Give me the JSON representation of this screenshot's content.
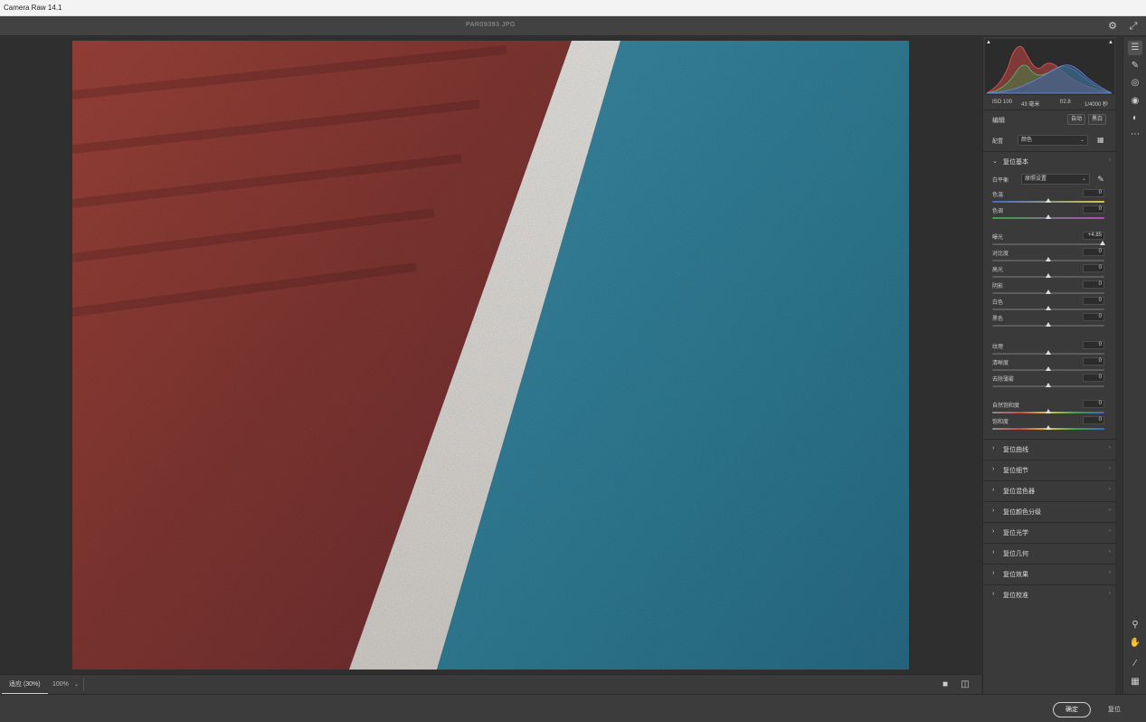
{
  "window": {
    "title": "Camera Raw 14.1"
  },
  "topbar": {
    "filename": "PAR09393.JPG",
    "settings_icon": "gear-icon",
    "fullscreen_icon": "expand-icon"
  },
  "histogram": {
    "exif": {
      "iso": "ISO 100",
      "focal": "43 毫米",
      "aperture": "f/2.8",
      "shutter": "1/4000 秒"
    }
  },
  "edit": {
    "label": "编辑",
    "auto": "自动",
    "bw": "黑白"
  },
  "profile": {
    "label": "配置",
    "value": "颜色"
  },
  "basic": {
    "title": "复位基本",
    "wb_label": "白平衡",
    "wb_value": "原照设置",
    "sliders": [
      {
        "label": "色温",
        "value": "0",
        "pos": 0.5,
        "track": "linear-gradient(90deg,#3f67c9,#d8c64a)"
      },
      {
        "label": "色调",
        "value": "0",
        "pos": 0.5,
        "track": "linear-gradient(90deg,#3fa04a,#b04ab8)"
      },
      {
        "label": "曝光",
        "value": "+4.85",
        "pos": 0.98,
        "track": ""
      },
      {
        "label": "对比度",
        "value": "0",
        "pos": 0.5,
        "track": ""
      },
      {
        "label": "高光",
        "value": "0",
        "pos": 0.5,
        "track": ""
      },
      {
        "label": "阴影",
        "value": "0",
        "pos": 0.5,
        "track": ""
      },
      {
        "label": "白色",
        "value": "0",
        "pos": 0.5,
        "track": ""
      },
      {
        "label": "黑色",
        "value": "0",
        "pos": 0.5,
        "track": ""
      },
      {
        "label": "纹理",
        "value": "0",
        "pos": 0.5,
        "track": ""
      },
      {
        "label": "清晰度",
        "value": "0",
        "pos": 0.5,
        "track": ""
      },
      {
        "label": "去除薄雾",
        "value": "0",
        "pos": 0.5,
        "track": ""
      },
      {
        "label": "自然饱和度",
        "value": "0",
        "pos": 0.5,
        "track": "linear-gradient(90deg,#8a8a8a,#c94a4a,#d8c64a,#3fa04a,#3f67c9)"
      },
      {
        "label": "饱和度",
        "value": "0",
        "pos": 0.5,
        "track": "linear-gradient(90deg,#8a8a8a,#c94a4a,#d8c64a,#3fa04a,#3f67c9)"
      }
    ]
  },
  "sections": [
    "复位曲线",
    "复位细节",
    "复位混色器",
    "复位颜色分级",
    "复位光学",
    "复位几何",
    "复位效果",
    "复位校准"
  ],
  "statusbar": {
    "fit": "适应 (30%)",
    "zoom": "100%"
  },
  "footer": {
    "ok": "确定",
    "cancel": "复位"
  },
  "colors": {
    "track_red": "#8c3a32",
    "track_blue": "#2f7d96",
    "line_white": "#d8d6d2",
    "panel_bg": "#3a3a3a"
  }
}
